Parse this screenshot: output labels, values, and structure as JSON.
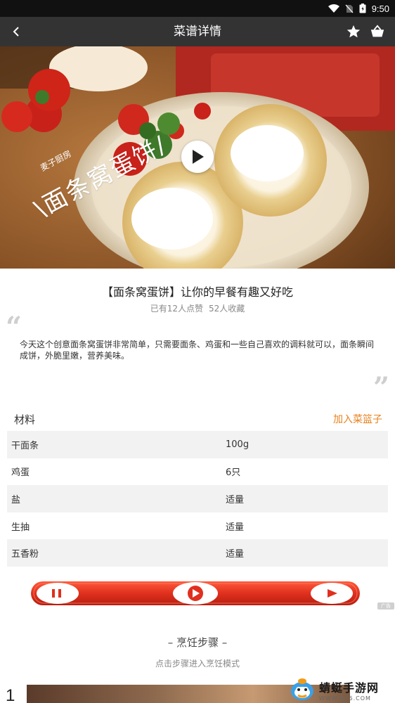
{
  "status_bar": {
    "time": "9:50"
  },
  "app_bar": {
    "title": "菜谱详情"
  },
  "hero": {
    "brand": "麦子厨房",
    "dish_title": "\\面条窝蛋饼/"
  },
  "recipe": {
    "title": "【面条窝蛋饼】让你的早餐有趣又好吃",
    "likes": "已有12人点赞",
    "favorites": "52人收藏",
    "description": "今天这个创意面条窝蛋饼非常简单，只需要面条、鸡蛋和一些自己喜欢的调料就可以，面条瞬间成饼，外脆里嫩，营养美味。"
  },
  "ingredients": {
    "heading": "材料",
    "add_label": "加入菜篮子",
    "items": [
      {
        "name": "干面条",
        "amount": "100g"
      },
      {
        "name": "鸡蛋",
        "amount": "6只"
      },
      {
        "name": "盐",
        "amount": "适量"
      },
      {
        "name": "生抽",
        "amount": "适量"
      },
      {
        "name": "五香粉",
        "amount": "适量"
      }
    ]
  },
  "ad": {
    "tag": "广告"
  },
  "steps": {
    "title": "– 烹饪步骤 –",
    "subtitle": "点击步骤进入烹饪模式",
    "first_number": "1"
  },
  "watermark": {
    "name": "蜻蜓手游网",
    "url": "WWW.QT6.COM"
  },
  "colors": {
    "accent": "#e8811c",
    "app_bar": "#333333",
    "player_red": "#e0301e"
  }
}
